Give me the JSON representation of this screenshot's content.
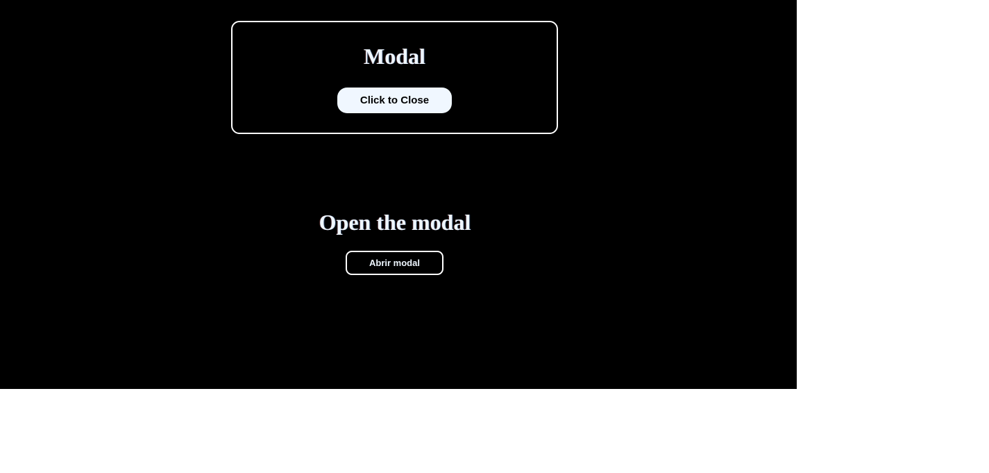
{
  "modal": {
    "title": "Modal",
    "close_button_label": "Click to Close"
  },
  "main": {
    "title": "Open the modal",
    "open_button_label": "Abrir modal"
  },
  "colors": {
    "page_background": "#000000",
    "outer_background": "#ffffff",
    "modal_border": "#ffffff",
    "close_button_background": "#f0f7ff",
    "text": "#eef6ff"
  }
}
